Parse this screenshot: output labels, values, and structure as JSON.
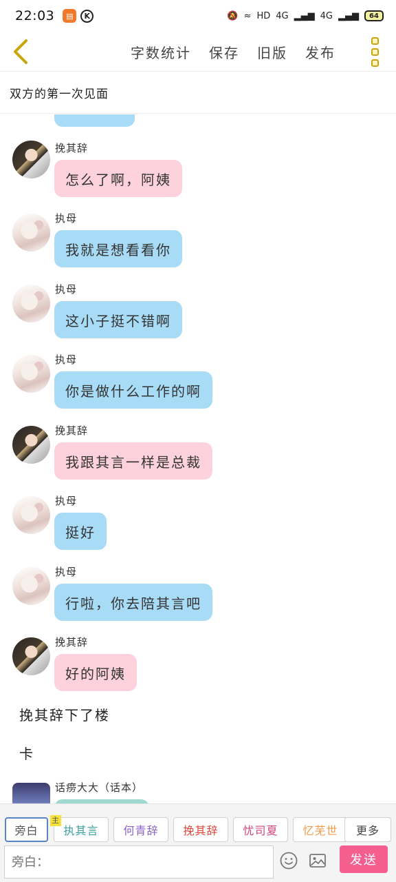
{
  "status": {
    "time": "22:03",
    "k_label": "K",
    "network": "HD",
    "signal1": "4G",
    "signal2": "4G",
    "battery": "64"
  },
  "toolbar": {
    "actions": [
      "字数统计",
      "保存",
      "旧版",
      "发布"
    ]
  },
  "title": "双方的第一次见面",
  "messages": [
    {
      "sender": "挽其辞",
      "text": "怎么了啊，阿姨",
      "color": "pink"
    },
    {
      "sender": "执母",
      "text": "我就是想看看你",
      "color": "blue"
    },
    {
      "sender": "执母",
      "text": "这小子挺不错啊",
      "color": "blue"
    },
    {
      "sender": "执母",
      "text": "你是做什么工作的啊",
      "color": "blue"
    },
    {
      "sender": "挽其辞",
      "text": "我跟其言一样是总裁",
      "color": "pink"
    },
    {
      "sender": "执母",
      "text": "挺好",
      "color": "blue"
    },
    {
      "sender": "执母",
      "text": "行啦，你去陪其言吧",
      "color": "blue"
    },
    {
      "sender": "挽其辞",
      "text": "好的阿姨",
      "color": "pink"
    }
  ],
  "narration": [
    "挽其辞下了楼",
    "卡"
  ],
  "narrator": {
    "sender": "话痨大大（话本）"
  },
  "char_tabs": {
    "narration": "旁白",
    "main_badge": "主",
    "names": [
      "执其言",
      "何青辞",
      "挽其辞",
      "忧司夏",
      "忆芜世"
    ],
    "more": "更多"
  },
  "input": {
    "placeholder": "旁白：",
    "send": "发送"
  },
  "colors": {
    "blue_bubble": "#a8dbf6",
    "pink_bubble": "#fdd2dc",
    "send": "#f55f90",
    "tab_names": [
      "#3aa0a0",
      "#8a63c4",
      "#e0463a",
      "#d0447c",
      "#f09a4a"
    ]
  }
}
